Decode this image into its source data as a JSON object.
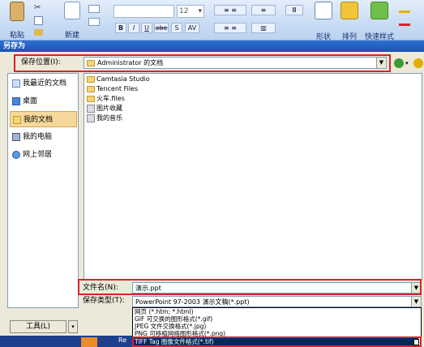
{
  "ribbon": {
    "paste_label": "粘贴",
    "new_slide_label": "新建",
    "font_size_value": "12",
    "bold": "B",
    "italic": "I",
    "underline": "U",
    "strike": "abe",
    "shadow": "S",
    "spacing": "AV",
    "shapes_label": "形状",
    "arrange_label": "排列",
    "quick_styles_label": "快速样式"
  },
  "dialog": {
    "title": "另存为",
    "save_in_label": "保存位置(I):",
    "save_in_value": "Administrator 的文档",
    "places": [
      {
        "label": "我最近的文档",
        "icon": "recent-docs-icon"
      },
      {
        "label": "桌面",
        "icon": "desktop-icon"
      },
      {
        "label": "我的文档",
        "icon": "my-documents-icon"
      },
      {
        "label": "我的电脑",
        "icon": "my-computer-icon"
      },
      {
        "label": "网上邻居",
        "icon": "network-icon"
      }
    ],
    "selected_place": "我的文档",
    "files": [
      {
        "name": "Camtasia Studio",
        "icon": "folder-icon"
      },
      {
        "name": "Tencent Files",
        "icon": "folder-icon"
      },
      {
        "name": "火车.files",
        "icon": "folder-icon"
      },
      {
        "name": "图片收藏",
        "icon": "pictures-folder-icon"
      },
      {
        "name": "我的音乐",
        "icon": "music-folder-icon"
      }
    ],
    "file_name_label": "文件名(N):",
    "file_name_value": "演示.ppt",
    "save_type_label": "保存类型(T):",
    "save_type_value": "PowerPoint 97-2003 演示文稿(*.ppt)",
    "type_options": [
      "网页 (*.htm; *.html)",
      "GIF 可交换的图形格式(*.gif)",
      "JPEG 文件交换格式(*.jpg)",
      "PNG 可移植网络图形格式(*.png)",
      "TIFF Tag 图像文件格式(*.tif)"
    ],
    "selected_type": "TIFF Tag 图像文件格式(*.tif)",
    "tools_label": "工具(L)",
    "taskbar_text": "Re"
  },
  "colors": {
    "highlight": "#d8232a",
    "selection": "#0a246a",
    "title_bar": "#2f6fd0"
  }
}
